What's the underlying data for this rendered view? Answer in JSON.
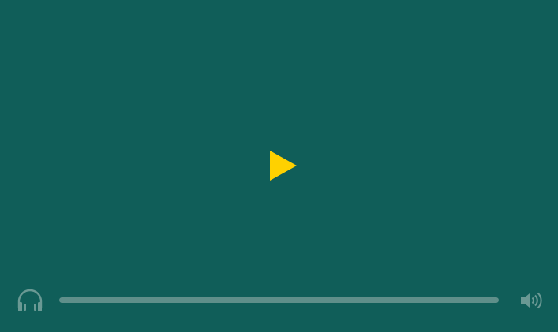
{
  "player": {
    "background_color": "#105e59",
    "play_icon": "play-icon",
    "play_color": "#ffd100",
    "left_icon": "headphones-icon",
    "right_icon": "volume-icon",
    "icon_color": "#6a9994",
    "progress": {
      "fraction": 0,
      "track_color": "#5f8f8a"
    }
  }
}
